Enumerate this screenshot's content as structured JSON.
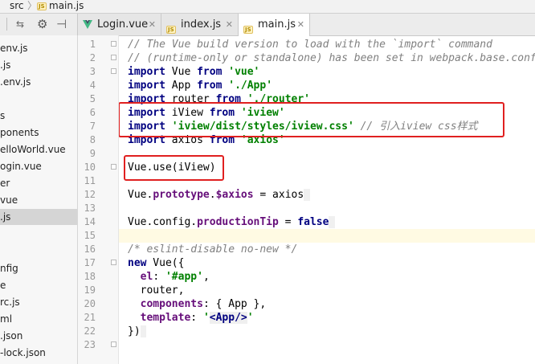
{
  "breadcrumb": {
    "folder": "src",
    "file": "main.js",
    "file_badge": "JS"
  },
  "tabs": [
    {
      "label": "Login.vue",
      "active": false
    },
    {
      "label": "index.js",
      "active": false
    },
    {
      "label": "main.js",
      "active": true
    }
  ],
  "sidebar": {
    "items": [
      {
        "label": "env.js"
      },
      {
        "label": ".js"
      },
      {
        "label": ".env.js"
      },
      {
        "label": ""
      },
      {
        "label": "s"
      },
      {
        "label": "ponents"
      },
      {
        "label": "elloWorld.vue"
      },
      {
        "label": "ogin.vue"
      },
      {
        "label": "er"
      },
      {
        "label": "vue"
      },
      {
        "label": ".js",
        "selected": true
      },
      {
        "label": ""
      },
      {
        "label": ""
      },
      {
        "label": "nfig"
      },
      {
        "label": "e"
      },
      {
        "label": "rc.js"
      },
      {
        "label": "ml"
      },
      {
        "label": ".json"
      },
      {
        "label": "-lock.json"
      }
    ]
  },
  "line_numbers": [
    "1",
    "2",
    "3",
    "4",
    "5",
    "6",
    "7",
    "8",
    "9",
    "10",
    "11",
    "12",
    "13",
    "14",
    "15",
    "16",
    "17",
    "18",
    "19",
    "20",
    "21",
    "22",
    "23"
  ],
  "code": {
    "l1": "// The Vue build version to load with the `import` command",
    "l2": "// (runtime-only or standalone) has been set in webpack.base.conf",
    "l3_kw": "import",
    "l3_id": " Vue ",
    "l3_from": "from",
    "l3_str": "'vue'",
    "l4_kw": "import",
    "l4_id": " App ",
    "l4_from": "from",
    "l4_str": "'./App'",
    "l5_kw": "import",
    "l5_id": " router ",
    "l5_from": "from",
    "l5_str": "'./router'",
    "l6_kw": "import",
    "l6_id": " iView ",
    "l6_from": "from",
    "l6_str": "'iview'",
    "l7_kw": "import",
    "l7_str": "'iview/dist/styles/iview.css'",
    "l7_cm": "// 引入iview css样式",
    "l8_kw": "import",
    "l8_id": " axios ",
    "l8_from": "from",
    "l8_str": "'axios'",
    "l10_obj": "Vue.",
    "l10_fn": "use",
    "l10_arg": "(iView)",
    "l12_obj": "Vue.",
    "l12_p": "prototype",
    "l12_dot": ".",
    "l12_p2": "$axios",
    "l12_rest": " = axios",
    "l14_obj": "Vue.config.",
    "l14_p": "productionTip",
    "l14_eq": " = ",
    "l14_kw": "false",
    "l16": "/* eslint-disable no-new */",
    "l17_kw": "new",
    "l17_rest": " Vue({",
    "l18_p": "el",
    "l18_c": ": ",
    "l18_s": "'#app'",
    "l18_e": ",",
    "l19": "router,",
    "l20_p": "components",
    "l20_rest": ": { App },",
    "l21_p": "template",
    "l21_c": ": ",
    "l21_s1": "'",
    "l21_tag": "<App/>",
    "l21_s2": "'",
    "l22": "})"
  }
}
